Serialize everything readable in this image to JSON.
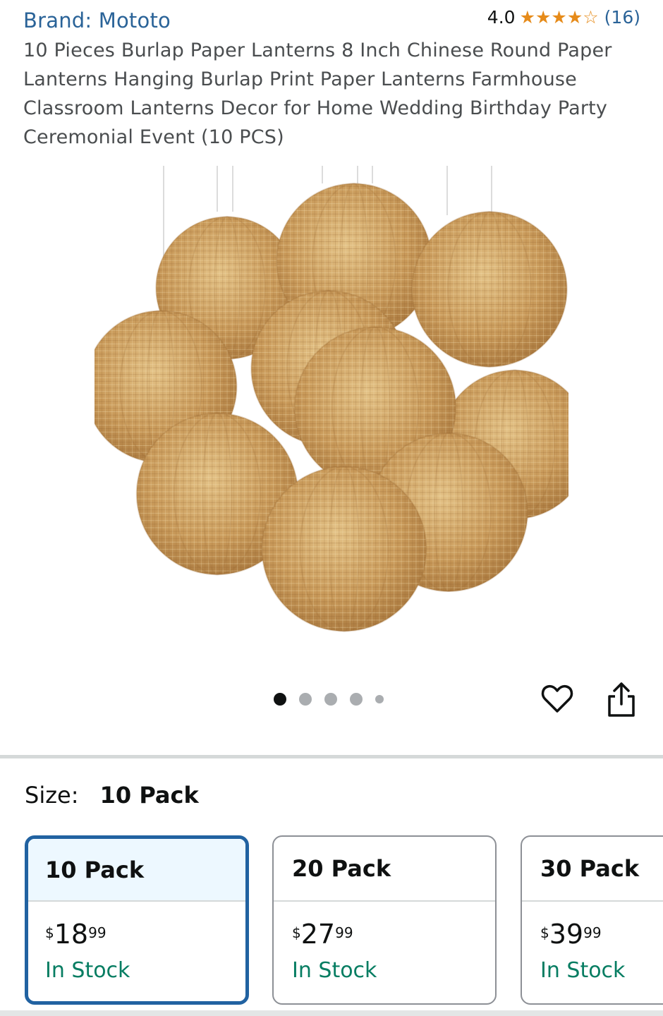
{
  "header": {
    "brand": "Brand: Mototo",
    "rating_value": "4.0",
    "rating_stars": 4,
    "rating_max": 5,
    "rating_count": "(16)",
    "title": "10 Pieces Burlap Paper Lanterns 8 Inch Chinese Round Paper Lanterns Hanging Burlap Print Paper Lanterns Farmhouse Classroom Lanterns Decor for Home Wedding Birthday Party Ceremonial Event (10 PCS)"
  },
  "gallery": {
    "image_count": 5,
    "active_index": 0,
    "icons": [
      "heart-icon",
      "share-icon"
    ]
  },
  "size": {
    "label": "Size:",
    "selected": "10 Pack",
    "options": [
      {
        "name": "10 Pack",
        "price_symbol": "$",
        "price_whole": "18",
        "price_fraction": "99",
        "stock": "In Stock",
        "selected": true
      },
      {
        "name": "20 Pack",
        "price_symbol": "$",
        "price_whole": "27",
        "price_fraction": "99",
        "stock": "In Stock",
        "selected": false
      },
      {
        "name": "30 Pack",
        "price_symbol": "$",
        "price_whole": "39",
        "price_fraction": "99",
        "stock": "In Stock",
        "selected": false
      }
    ]
  },
  "colors": {
    "link": "#2a6398",
    "star": "#e68b1a",
    "in_stock": "#067d62",
    "selected_border": "#2162a1",
    "selected_bg": "#edf8ff"
  }
}
